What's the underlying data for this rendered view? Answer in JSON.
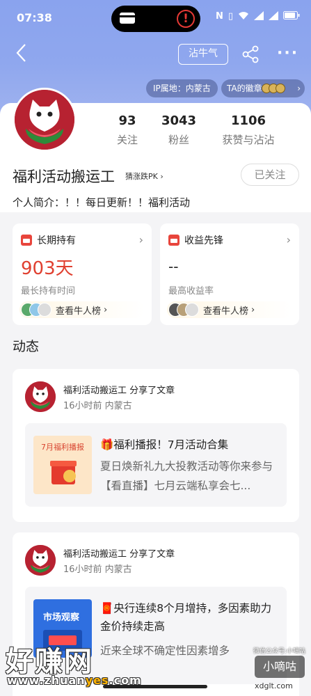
{
  "status_bar": {
    "time": "07:38",
    "icons": [
      "nfc-icon",
      "vibrate-icon",
      "wifi-icon",
      "signal-icon",
      "signal-icon",
      "battery-icon"
    ],
    "battery_label": "▮"
  },
  "header": {
    "zhan_button": "沾牛气",
    "ip_location": "IP属地：内蒙古",
    "badges_label": "TA的徽章"
  },
  "profile": {
    "username": "福利活动搬运工",
    "pk_link": "猜涨跌PK",
    "follow_button": "已关注",
    "bio": "个人简介：！！每日更新！！福利活动",
    "stats": [
      {
        "value": "93",
        "label": "关注"
      },
      {
        "value": "3043",
        "label": "粉丝"
      },
      {
        "value": "1106",
        "label": "获赞与沾沾"
      }
    ]
  },
  "cards": [
    {
      "title": "长期持有",
      "value": "903天",
      "value_color": "#e04030",
      "subtitle": "最长持有时间",
      "link": "查看牛人榜"
    },
    {
      "title": "收益先锋",
      "value": "--",
      "value_color": "#222222",
      "subtitle": "最高收益率",
      "link": "查看牛人榜"
    }
  ],
  "section_title": "动态",
  "posts": [
    {
      "author": "福利活动搬运工  分享了文章",
      "time": "16小时前  内蒙古",
      "thumb_label": "7月福利播报",
      "title": "🎁福利播报！7月活动合集",
      "desc": "夏日焕新礼九大投教活动等你来参与【看直播】七月云端私享会七..."
    },
    {
      "author": "福利活动搬运工  分享了文章",
      "time": "16小时前  内蒙古",
      "thumb_label": "市场观察",
      "title": "🧧央行连续8个月增持，多因素助力金价持续走高",
      "desc": "近来全球不确定性因素增多"
    }
  ],
  "watermark": {
    "big": "好赚网",
    "url_a": "www.zhuan",
    "url_hl": "yes",
    "url_b": ".com",
    "right": "小嘀咕",
    "right_small": "微信公众号:小嘀咕",
    "domain": "xdglt.com"
  }
}
